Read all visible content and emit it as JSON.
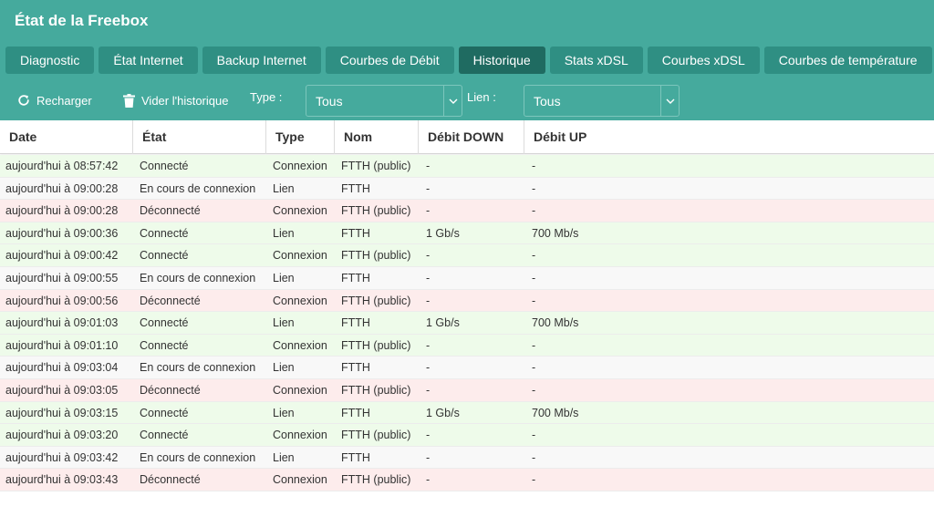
{
  "app": {
    "title": "État de la Freebox"
  },
  "tabs": [
    {
      "label": "Diagnostic",
      "active": false
    },
    {
      "label": "État Internet",
      "active": false
    },
    {
      "label": "Backup Internet",
      "active": false
    },
    {
      "label": "Courbes de Débit",
      "active": false
    },
    {
      "label": "Historique",
      "active": true
    },
    {
      "label": "Stats xDSL",
      "active": false
    },
    {
      "label": "Courbes xDSL",
      "active": false
    },
    {
      "label": "Courbes de température",
      "active": false
    }
  ],
  "toolbar": {
    "reload_label": "Recharger",
    "reload_icon": "refresh-icon",
    "clear_label": "Vider l'historique",
    "clear_icon": "trash-icon",
    "type_label": "Type :",
    "type_value": "Tous",
    "link_label": "Lien :",
    "link_value": "Tous"
  },
  "table": {
    "columns": [
      "Date",
      "État",
      "Type",
      "Nom",
      "Débit DOWN",
      "Débit UP"
    ],
    "rows": [
      {
        "date": "aujourd'hui à 08:57:42",
        "state": "Connecté",
        "type": "Connexion",
        "name": "FTTH (public)",
        "down": "-",
        "up": "-"
      },
      {
        "date": "aujourd'hui à 09:00:28",
        "state": "En cours de connexion",
        "type": "Lien",
        "name": "FTTH",
        "down": "-",
        "up": "-"
      },
      {
        "date": "aujourd'hui à 09:00:28",
        "state": "Déconnecté",
        "type": "Connexion",
        "name": "FTTH (public)",
        "down": "-",
        "up": "-"
      },
      {
        "date": "aujourd'hui à 09:00:36",
        "state": "Connecté",
        "type": "Lien",
        "name": "FTTH",
        "down": "1 Gb/s",
        "up": "700 Mb/s"
      },
      {
        "date": "aujourd'hui à 09:00:42",
        "state": "Connecté",
        "type": "Connexion",
        "name": "FTTH (public)",
        "down": "-",
        "up": "-"
      },
      {
        "date": "aujourd'hui à 09:00:55",
        "state": "En cours de connexion",
        "type": "Lien",
        "name": "FTTH",
        "down": "-",
        "up": "-"
      },
      {
        "date": "aujourd'hui à 09:00:56",
        "state": "Déconnecté",
        "type": "Connexion",
        "name": "FTTH (public)",
        "down": "-",
        "up": "-"
      },
      {
        "date": "aujourd'hui à 09:01:03",
        "state": "Connecté",
        "type": "Lien",
        "name": "FTTH",
        "down": "1 Gb/s",
        "up": "700 Mb/s"
      },
      {
        "date": "aujourd'hui à 09:01:10",
        "state": "Connecté",
        "type": "Connexion",
        "name": "FTTH (public)",
        "down": "-",
        "up": "-"
      },
      {
        "date": "aujourd'hui à 09:03:04",
        "state": "En cours de connexion",
        "type": "Lien",
        "name": "FTTH",
        "down": "-",
        "up": "-"
      },
      {
        "date": "aujourd'hui à 09:03:05",
        "state": "Déconnecté",
        "type": "Connexion",
        "name": "FTTH (public)",
        "down": "-",
        "up": "-"
      },
      {
        "date": "aujourd'hui à 09:03:15",
        "state": "Connecté",
        "type": "Lien",
        "name": "FTTH",
        "down": "1 Gb/s",
        "up": "700 Mb/s"
      },
      {
        "date": "aujourd'hui à 09:03:20",
        "state": "Connecté",
        "type": "Connexion",
        "name": "FTTH (public)",
        "down": "-",
        "up": "-"
      },
      {
        "date": "aujourd'hui à 09:03:42",
        "state": "En cours de connexion",
        "type": "Lien",
        "name": "FTTH",
        "down": "-",
        "up": "-"
      },
      {
        "date": "aujourd'hui à 09:03:43",
        "state": "Déconnecté",
        "type": "Connexion",
        "name": "FTTH (public)",
        "down": "-",
        "up": "-"
      }
    ]
  },
  "colors": {
    "header": "#45aa9d",
    "tab": "#2f8f83",
    "tab_active": "#1f6b61",
    "row_connected": "#eefbea",
    "row_connecting": "#f8f8f8",
    "row_disconnected": "#fdecec"
  }
}
